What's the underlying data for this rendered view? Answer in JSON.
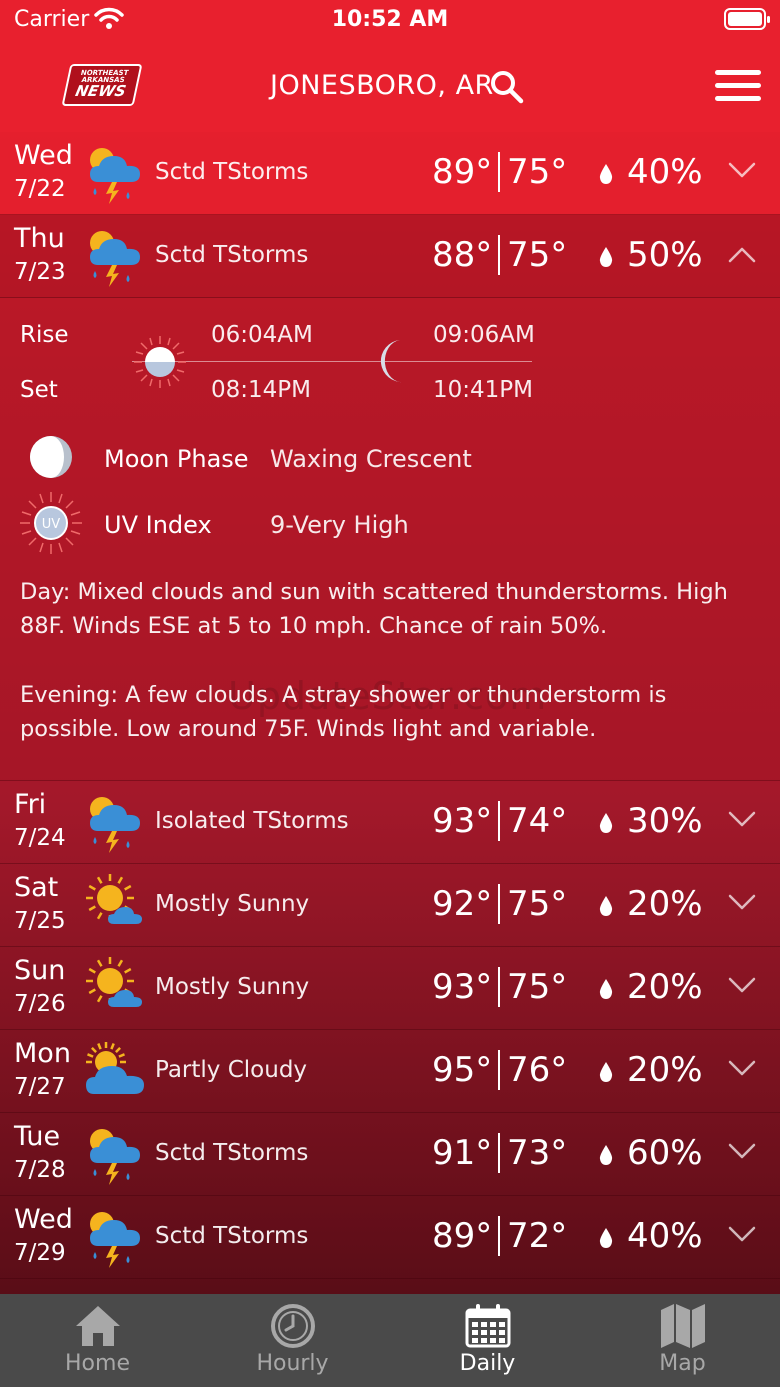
{
  "status_bar": {
    "carrier": "Carrier",
    "time": "10:52 AM"
  },
  "header": {
    "logo_small": "NORTHEAST ARKANSAS",
    "logo_big": "NEWS",
    "city": "JONESBORO, AR"
  },
  "days_top": [
    {
      "name": "Wed",
      "date": "7/22",
      "condition": "Sctd TStorms",
      "icon": "thunderstorm-icon",
      "hi": "89°",
      "lo": "75°",
      "precip": "40%",
      "expanded": false
    },
    {
      "name": "Thu",
      "date": "7/23",
      "condition": "Sctd TStorms",
      "icon": "thunderstorm-icon",
      "hi": "88°",
      "lo": "75°",
      "precip": "50%",
      "expanded": true
    }
  ],
  "details": {
    "rise_label": "Rise",
    "set_label": "Set",
    "sunrise": "06:04AM",
    "sunset": "08:14PM",
    "moonrise": "09:06AM",
    "moonset": "10:41PM",
    "moon_phase_label": "Moon Phase",
    "moon_phase_value": "Waxing Crescent",
    "uv_label": "UV Index",
    "uv_value": "9-Very High",
    "uv_icon_text": "UV",
    "day_label": "Day",
    "day_text": ": Mixed clouds and sun with scattered thunderstorms. High 88F. Winds ESE at 5 to 10 mph. Chance of rain 50%.",
    "evening_label": "Evening",
    "evening_text": ": A few clouds. A stray shower or thunderstorm is possible. Low around 75F. Winds light and variable.",
    "watermark": "UpdateStar.com"
  },
  "days_bottom": [
    {
      "name": "Fri",
      "date": "7/24",
      "condition": "Isolated TStorms",
      "icon": "thunderstorm-icon",
      "hi": "93°",
      "lo": "74°",
      "precip": "30%"
    },
    {
      "name": "Sat",
      "date": "7/25",
      "condition": "Mostly Sunny",
      "icon": "mostly-sunny-icon",
      "hi": "92°",
      "lo": "75°",
      "precip": "20%"
    },
    {
      "name": "Sun",
      "date": "7/26",
      "condition": "Mostly Sunny",
      "icon": "mostly-sunny-icon",
      "hi": "93°",
      "lo": "75°",
      "precip": "20%"
    },
    {
      "name": "Mon",
      "date": "7/27",
      "condition": "Partly Cloudy",
      "icon": "partly-cloudy-icon",
      "hi": "95°",
      "lo": "76°",
      "precip": "20%"
    },
    {
      "name": "Tue",
      "date": "7/28",
      "condition": "Sctd TStorms",
      "icon": "thunderstorm-icon",
      "hi": "91°",
      "lo": "73°",
      "precip": "60%"
    },
    {
      "name": "Wed",
      "date": "7/29",
      "condition": "Sctd TStorms",
      "icon": "thunderstorm-icon",
      "hi": "89°",
      "lo": "72°",
      "precip": "40%"
    }
  ],
  "tabs": [
    {
      "label": "Home",
      "icon": "home-icon",
      "active": false
    },
    {
      "label": "Hourly",
      "icon": "clock-icon",
      "active": false
    },
    {
      "label": "Daily",
      "icon": "calendar-icon",
      "active": true
    },
    {
      "label": "Map",
      "icon": "map-icon",
      "active": false
    }
  ],
  "colors": {
    "header": "#e8202e",
    "tabbar": "#4a4a4a",
    "sun": "#f5b41e",
    "cloud": "#3a8fd6"
  }
}
